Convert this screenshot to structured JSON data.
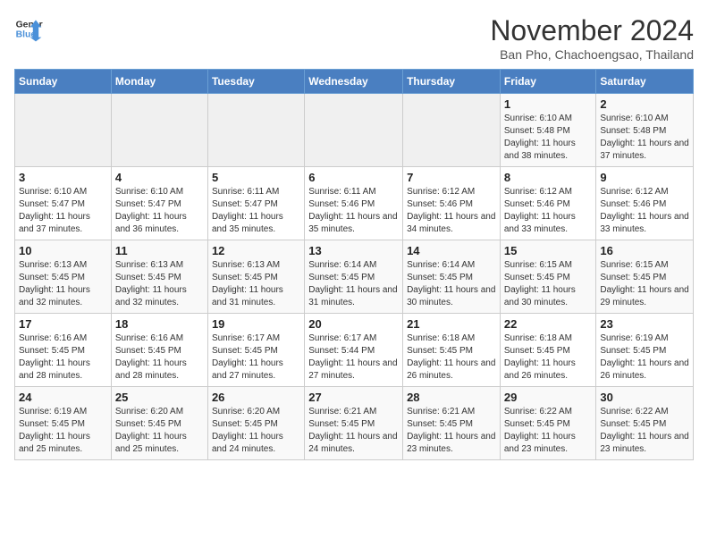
{
  "header": {
    "logo_line1": "General",
    "logo_line2": "Blue",
    "month_title": "November 2024",
    "subtitle": "Ban Pho, Chachoengsao, Thailand"
  },
  "weekdays": [
    "Sunday",
    "Monday",
    "Tuesday",
    "Wednesday",
    "Thursday",
    "Friday",
    "Saturday"
  ],
  "weeks": [
    [
      {
        "day": "",
        "info": ""
      },
      {
        "day": "",
        "info": ""
      },
      {
        "day": "",
        "info": ""
      },
      {
        "day": "",
        "info": ""
      },
      {
        "day": "",
        "info": ""
      },
      {
        "day": "1",
        "info": "Sunrise: 6:10 AM\nSunset: 5:48 PM\nDaylight: 11 hours and 38 minutes."
      },
      {
        "day": "2",
        "info": "Sunrise: 6:10 AM\nSunset: 5:48 PM\nDaylight: 11 hours and 37 minutes."
      }
    ],
    [
      {
        "day": "3",
        "info": "Sunrise: 6:10 AM\nSunset: 5:47 PM\nDaylight: 11 hours and 37 minutes."
      },
      {
        "day": "4",
        "info": "Sunrise: 6:10 AM\nSunset: 5:47 PM\nDaylight: 11 hours and 36 minutes."
      },
      {
        "day": "5",
        "info": "Sunrise: 6:11 AM\nSunset: 5:47 PM\nDaylight: 11 hours and 35 minutes."
      },
      {
        "day": "6",
        "info": "Sunrise: 6:11 AM\nSunset: 5:46 PM\nDaylight: 11 hours and 35 minutes."
      },
      {
        "day": "7",
        "info": "Sunrise: 6:12 AM\nSunset: 5:46 PM\nDaylight: 11 hours and 34 minutes."
      },
      {
        "day": "8",
        "info": "Sunrise: 6:12 AM\nSunset: 5:46 PM\nDaylight: 11 hours and 33 minutes."
      },
      {
        "day": "9",
        "info": "Sunrise: 6:12 AM\nSunset: 5:46 PM\nDaylight: 11 hours and 33 minutes."
      }
    ],
    [
      {
        "day": "10",
        "info": "Sunrise: 6:13 AM\nSunset: 5:45 PM\nDaylight: 11 hours and 32 minutes."
      },
      {
        "day": "11",
        "info": "Sunrise: 6:13 AM\nSunset: 5:45 PM\nDaylight: 11 hours and 32 minutes."
      },
      {
        "day": "12",
        "info": "Sunrise: 6:13 AM\nSunset: 5:45 PM\nDaylight: 11 hours and 31 minutes."
      },
      {
        "day": "13",
        "info": "Sunrise: 6:14 AM\nSunset: 5:45 PM\nDaylight: 11 hours and 31 minutes."
      },
      {
        "day": "14",
        "info": "Sunrise: 6:14 AM\nSunset: 5:45 PM\nDaylight: 11 hours and 30 minutes."
      },
      {
        "day": "15",
        "info": "Sunrise: 6:15 AM\nSunset: 5:45 PM\nDaylight: 11 hours and 30 minutes."
      },
      {
        "day": "16",
        "info": "Sunrise: 6:15 AM\nSunset: 5:45 PM\nDaylight: 11 hours and 29 minutes."
      }
    ],
    [
      {
        "day": "17",
        "info": "Sunrise: 6:16 AM\nSunset: 5:45 PM\nDaylight: 11 hours and 28 minutes."
      },
      {
        "day": "18",
        "info": "Sunrise: 6:16 AM\nSunset: 5:45 PM\nDaylight: 11 hours and 28 minutes."
      },
      {
        "day": "19",
        "info": "Sunrise: 6:17 AM\nSunset: 5:45 PM\nDaylight: 11 hours and 27 minutes."
      },
      {
        "day": "20",
        "info": "Sunrise: 6:17 AM\nSunset: 5:44 PM\nDaylight: 11 hours and 27 minutes."
      },
      {
        "day": "21",
        "info": "Sunrise: 6:18 AM\nSunset: 5:45 PM\nDaylight: 11 hours and 26 minutes."
      },
      {
        "day": "22",
        "info": "Sunrise: 6:18 AM\nSunset: 5:45 PM\nDaylight: 11 hours and 26 minutes."
      },
      {
        "day": "23",
        "info": "Sunrise: 6:19 AM\nSunset: 5:45 PM\nDaylight: 11 hours and 26 minutes."
      }
    ],
    [
      {
        "day": "24",
        "info": "Sunrise: 6:19 AM\nSunset: 5:45 PM\nDaylight: 11 hours and 25 minutes."
      },
      {
        "day": "25",
        "info": "Sunrise: 6:20 AM\nSunset: 5:45 PM\nDaylight: 11 hours and 25 minutes."
      },
      {
        "day": "26",
        "info": "Sunrise: 6:20 AM\nSunset: 5:45 PM\nDaylight: 11 hours and 24 minutes."
      },
      {
        "day": "27",
        "info": "Sunrise: 6:21 AM\nSunset: 5:45 PM\nDaylight: 11 hours and 24 minutes."
      },
      {
        "day": "28",
        "info": "Sunrise: 6:21 AM\nSunset: 5:45 PM\nDaylight: 11 hours and 23 minutes."
      },
      {
        "day": "29",
        "info": "Sunrise: 6:22 AM\nSunset: 5:45 PM\nDaylight: 11 hours and 23 minutes."
      },
      {
        "day": "30",
        "info": "Sunrise: 6:22 AM\nSunset: 5:45 PM\nDaylight: 11 hours and 23 minutes."
      }
    ]
  ]
}
